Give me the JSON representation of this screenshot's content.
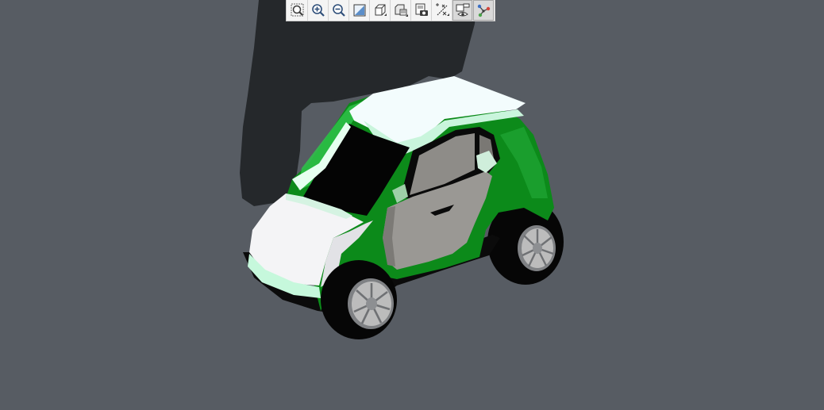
{
  "viewer": {
    "background_color": "#575c63",
    "shadow_color": "#25282b",
    "model": {
      "body_color": "#0c8a1a",
      "roof_color": "#f3fcfd",
      "glass_color": "#040404",
      "door_color": "#9a9894",
      "tire_color": "#060606",
      "rim_color": "#bcbcbc"
    }
  },
  "toolbar": {
    "items": [
      {
        "icon": "zoom-fit-icon",
        "active": false
      },
      {
        "icon": "zoom-in-icon",
        "active": false
      },
      {
        "icon": "zoom-out-icon",
        "active": false
      },
      {
        "icon": "zoom-window-icon",
        "active": false
      },
      {
        "icon": "view-orientation-icon",
        "active": false
      },
      {
        "icon": "display-style-icon",
        "active": false
      },
      {
        "icon": "snapshot-icon",
        "active": false
      },
      {
        "icon": "measure-icon",
        "active": false
      },
      {
        "icon": "hide-show-icon",
        "active": true
      },
      {
        "icon": "explode-icon",
        "active": true
      }
    ]
  }
}
